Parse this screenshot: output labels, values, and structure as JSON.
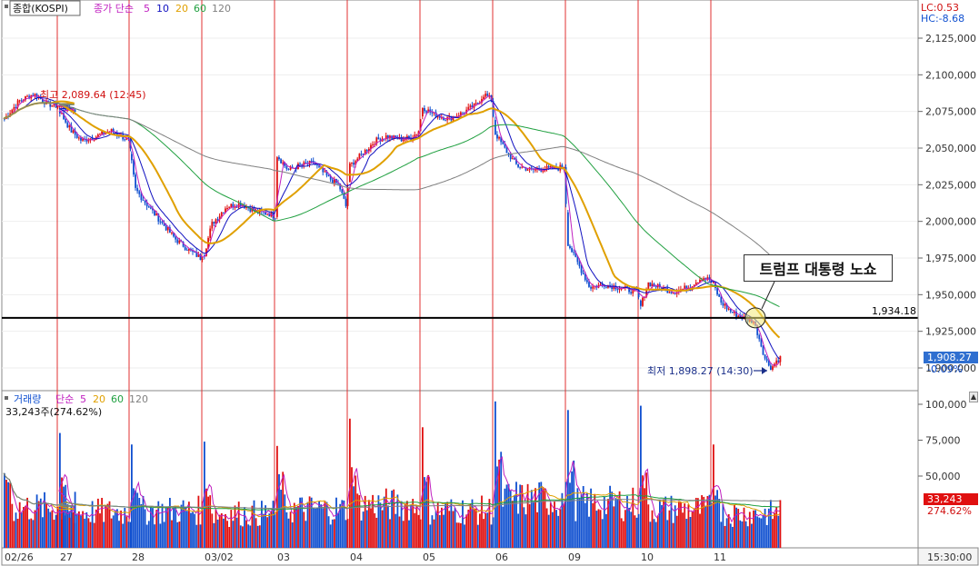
{
  "legend_price": {
    "name": "종합(KOSPI)",
    "label": "종가 단순",
    "periods": [
      "5",
      "10",
      "20",
      "60",
      "120"
    ],
    "period_colors": [
      "#c020c0",
      "#1010c0",
      "#e0a000",
      "#20a040",
      "#808080"
    ]
  },
  "legend_volume": {
    "name": "거래량",
    "label": "단순",
    "periods": [
      "5",
      "20",
      "60",
      "120"
    ],
    "period_colors": [
      "#c020c0",
      "#e0a000",
      "#20a040",
      "#808080"
    ],
    "current": "33,243주(274.62%)"
  },
  "corner": {
    "lc": "LC:0.53",
    "hc": "HC:-8.68"
  },
  "news": "트럼프 대통령 노쇼",
  "high_annotation": "최고 2,089.64 (12:45)",
  "low_annotation": "최저 1,898.27 (14:30)",
  "threshold": {
    "value": 1934.18,
    "label": "1,934.18"
  },
  "last_price": {
    "value": "1,908.27",
    "change": "-0.09%"
  },
  "last_volume": {
    "value": "33,243",
    "change": "274.62%"
  },
  "time_label": "15:30:00",
  "colors": {
    "up": "#e01010",
    "down": "#1050d0",
    "frame": "#888888",
    "highlight": "#2f6fd0"
  },
  "chart_data": [
    {
      "type": "candlestick",
      "title": "종합(KOSPI)",
      "x_labels": [
        "02/26",
        "27",
        "28",
        "03/02",
        "03",
        "04",
        "05",
        "06",
        "09",
        "10",
        "11"
      ],
      "ylim": [
        1880,
        2140
      ],
      "y_ticks": [
        "2,125,000",
        "2,100,000",
        "2,075,000",
        "2,050,000",
        "2,025,000",
        "2,000,000",
        "1,975,000",
        "1,950,000",
        "1,925,000",
        "1,900,000"
      ],
      "y_tick_values": [
        2125,
        2100,
        2075,
        2050,
        2025,
        2000,
        1975,
        1950,
        1925,
        1900
      ],
      "anchors": [
        [
          0,
          2070
        ],
        [
          0.2,
          2082
        ],
        [
          0.4,
          2087
        ],
        [
          0.6,
          2080
        ],
        [
          0.8,
          2078
        ],
        [
          1.0,
          2075
        ],
        [
          1.15,
          2062
        ],
        [
          1.3,
          2055
        ],
        [
          1.5,
          2058
        ],
        [
          1.7,
          2062
        ],
        [
          1.85,
          2058
        ],
        [
          1.95,
          2055
        ],
        [
          2.0,
          2040
        ],
        [
          2.05,
          2022
        ],
        [
          2.2,
          2012
        ],
        [
          2.4,
          2000
        ],
        [
          2.6,
          1988
        ],
        [
          2.8,
          1980
        ],
        [
          2.95,
          1975
        ],
        [
          3.0,
          1978
        ],
        [
          3.1,
          1998
        ],
        [
          3.3,
          2010
        ],
        [
          3.5,
          2012
        ],
        [
          3.7,
          2007
        ],
        [
          3.9,
          2005
        ],
        [
          3.98,
          2003
        ],
        [
          4.0,
          2045
        ],
        [
          4.15,
          2035
        ],
        [
          4.3,
          2038
        ],
        [
          4.5,
          2040
        ],
        [
          4.7,
          2030
        ],
        [
          4.85,
          2025
        ],
        [
          4.95,
          2010
        ],
        [
          5.0,
          2038
        ],
        [
          5.15,
          2045
        ],
        [
          5.35,
          2055
        ],
        [
          5.5,
          2058
        ],
        [
          5.7,
          2056
        ],
        [
          5.85,
          2057
        ],
        [
          5.95,
          2062
        ],
        [
          6.0,
          2078
        ],
        [
          6.15,
          2073
        ],
        [
          6.35,
          2070
        ],
        [
          6.55,
          2074
        ],
        [
          6.75,
          2080
        ],
        [
          6.85,
          2087
        ],
        [
          6.95,
          2083
        ],
        [
          7.0,
          2060
        ],
        [
          7.15,
          2048
        ],
        [
          7.3,
          2038
        ],
        [
          7.5,
          2035
        ],
        [
          7.7,
          2036
        ],
        [
          7.85,
          2036
        ],
        [
          7.95,
          2038
        ],
        [
          8.0,
          1985
        ],
        [
          8.15,
          1970
        ],
        [
          8.3,
          1955
        ],
        [
          8.5,
          1957
        ],
        [
          8.7,
          1955
        ],
        [
          8.85,
          1953
        ],
        [
          8.95,
          1952
        ],
        [
          9.0,
          1942
        ],
        [
          9.1,
          1958
        ],
        [
          9.25,
          1955
        ],
        [
          9.45,
          1952
        ],
        [
          9.65,
          1955
        ],
        [
          9.85,
          1962
        ],
        [
          9.95,
          1960
        ],
        [
          10.0,
          1957
        ],
        [
          10.1,
          1945
        ],
        [
          10.25,
          1938
        ],
        [
          10.45,
          1933
        ],
        [
          10.55,
          1932
        ],
        [
          10.62,
          1922
        ],
        [
          10.72,
          1905
        ],
        [
          10.8,
          1900
        ],
        [
          10.87,
          1905
        ],
        [
          10.95,
          1908
        ]
      ],
      "ma_periods": [
        5,
        10,
        20,
        60,
        120
      ],
      "ma_colors": [
        "#c020c0",
        "#1010c0",
        "#e0a000",
        "#20a040",
        "#808080"
      ],
      "high": 2089.64,
      "low": 1898.27
    },
    {
      "type": "bar",
      "title": "거래량",
      "ylim": [
        0,
        105000
      ],
      "y_ticks": [
        "100,000",
        "75,000",
        "50,000"
      ],
      "y_tick_values": [
        100000,
        75000,
        50000
      ],
      "day_open_spikes": [
        52000,
        80000,
        72000,
        74000,
        71000,
        90000,
        84000,
        102000,
        96000,
        99000,
        72000
      ],
      "session_avg": [
        28000,
        25000,
        26000,
        24000,
        27000,
        30000,
        26000,
        34000,
        31000,
        27000,
        24000
      ],
      "last": 33243
    }
  ]
}
